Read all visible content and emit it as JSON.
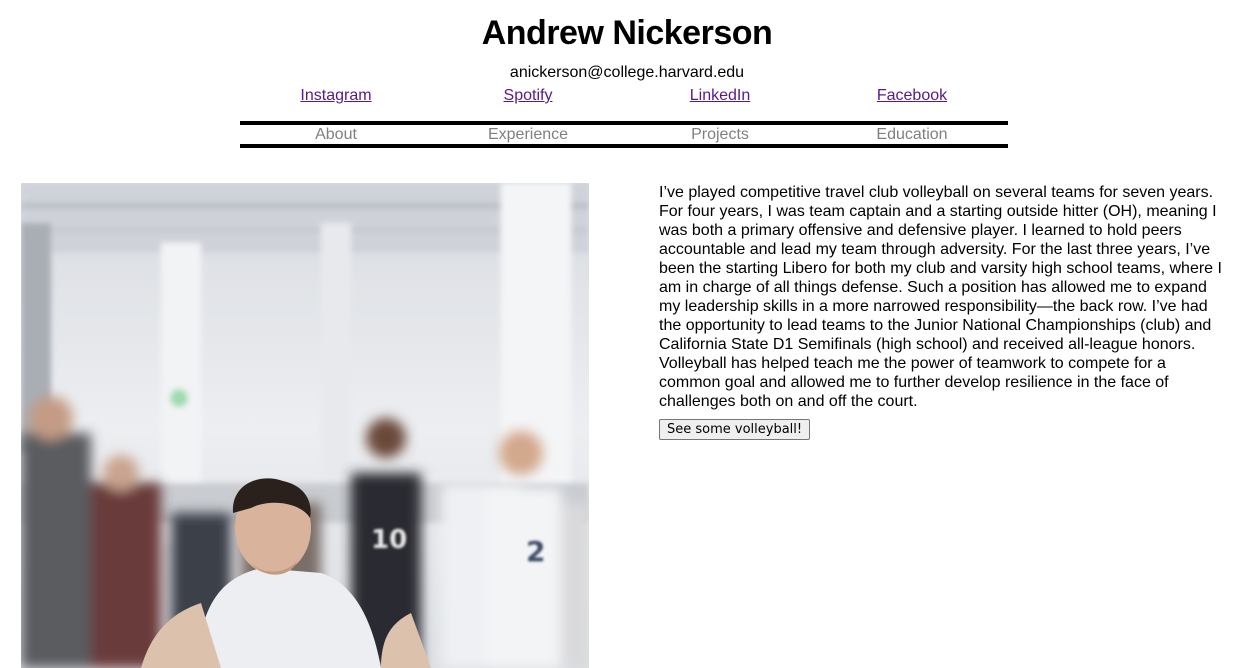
{
  "header": {
    "name": "Andrew Nickerson",
    "email": "anickerson@college.harvard.edu"
  },
  "social_links": [
    {
      "label": "Instagram"
    },
    {
      "label": "Spotify"
    },
    {
      "label": "LinkedIn"
    },
    {
      "label": "Facebook"
    }
  ],
  "nav": [
    {
      "label": "About"
    },
    {
      "label": "Experience"
    },
    {
      "label": "Projects"
    },
    {
      "label": "Education"
    }
  ],
  "bio": {
    "text": "I’ve played competitive travel club volleyball on several teams for seven years. For four years, I was team captain and a starting outside hitter (OH), meaning I was both a primary offensive and defensive player. I learned to hold peers accountable and lead my team through adversity. For the last three years, I’ve been the starting Libero for both my club and varsity high school teams, where I am in charge of all things defense. Such a position has allowed me to expand my leadership skills in a more narrowed responsibility—the back row. I’ve had the opportunity to lead teams to the Junior National Championships (club) and California State D1 Semifinals (high school) and received all-league honors. Volleyball has helped teach me the power of teamwork to compete for a common goal and allowed me to further develop resilience in the face of challenges both on and off the court.",
    "button_label": "See some volleyball!"
  },
  "photo": {
    "jersey_numbers": [
      "10",
      "2"
    ]
  },
  "colors": {
    "visited_link": "#551a8b",
    "nav_text": "#808080",
    "rule": "#000000"
  }
}
